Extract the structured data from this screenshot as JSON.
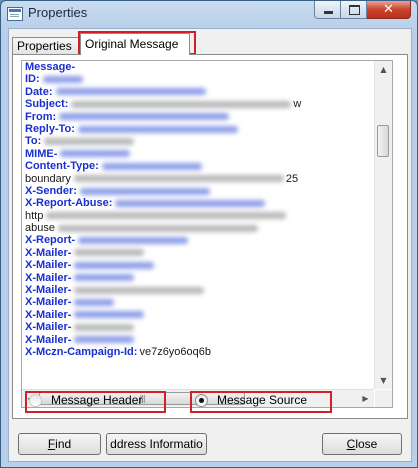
{
  "window": {
    "title": "Properties",
    "close_glyph": "✕"
  },
  "tabs": [
    {
      "label": "Properties",
      "active": false
    },
    {
      "label": "Original Message",
      "active": true
    }
  ],
  "message_lines": [
    {
      "label": "Message-",
      "kind": "header"
    },
    {
      "label": "ID:",
      "kind": "header"
    },
    {
      "label": "Date:",
      "kind": "header"
    },
    {
      "label": "Subject:",
      "kind": "header",
      "trail": "w"
    },
    {
      "label": "From:",
      "kind": "header"
    },
    {
      "label": "Reply-To:",
      "kind": "header"
    },
    {
      "label": "To:",
      "kind": "header"
    },
    {
      "label": "MIME-",
      "kind": "header"
    },
    {
      "label": "Content-Type:",
      "kind": "header"
    },
    {
      "label": "boundary",
      "kind": "text",
      "trail": "25"
    },
    {
      "label": "X-Sender:",
      "kind": "header"
    },
    {
      "label": "X-Report-Abuse:",
      "kind": "header"
    },
    {
      "label": "http",
      "kind": "text"
    },
    {
      "label": "abuse",
      "kind": "text"
    },
    {
      "label": "X-Report-",
      "kind": "header"
    },
    {
      "label": "X-Mailer-",
      "kind": "header"
    },
    {
      "label": "X-Mailer-",
      "kind": "header"
    },
    {
      "label": "X-Mailer-",
      "kind": "header"
    },
    {
      "label": "X-Mailer-",
      "kind": "header"
    },
    {
      "label": "X-Mailer-",
      "kind": "header"
    },
    {
      "label": "X-Mailer-",
      "kind": "header"
    },
    {
      "label": "X-Mailer-",
      "kind": "header"
    },
    {
      "label": "X-Mailer-",
      "kind": "header"
    },
    {
      "label": "X-Mczn-Campaign-Id:",
      "kind": "header",
      "trail": "ve7z6yo6oq6b"
    }
  ],
  "view_options": {
    "header_label": "Message Header",
    "source_label": "Message Source",
    "selected": "source"
  },
  "buttons": {
    "find": {
      "first": "F",
      "rest": "ind"
    },
    "address_info": "ddress Informatio",
    "close": {
      "first": "C",
      "rest": "lose"
    }
  }
}
